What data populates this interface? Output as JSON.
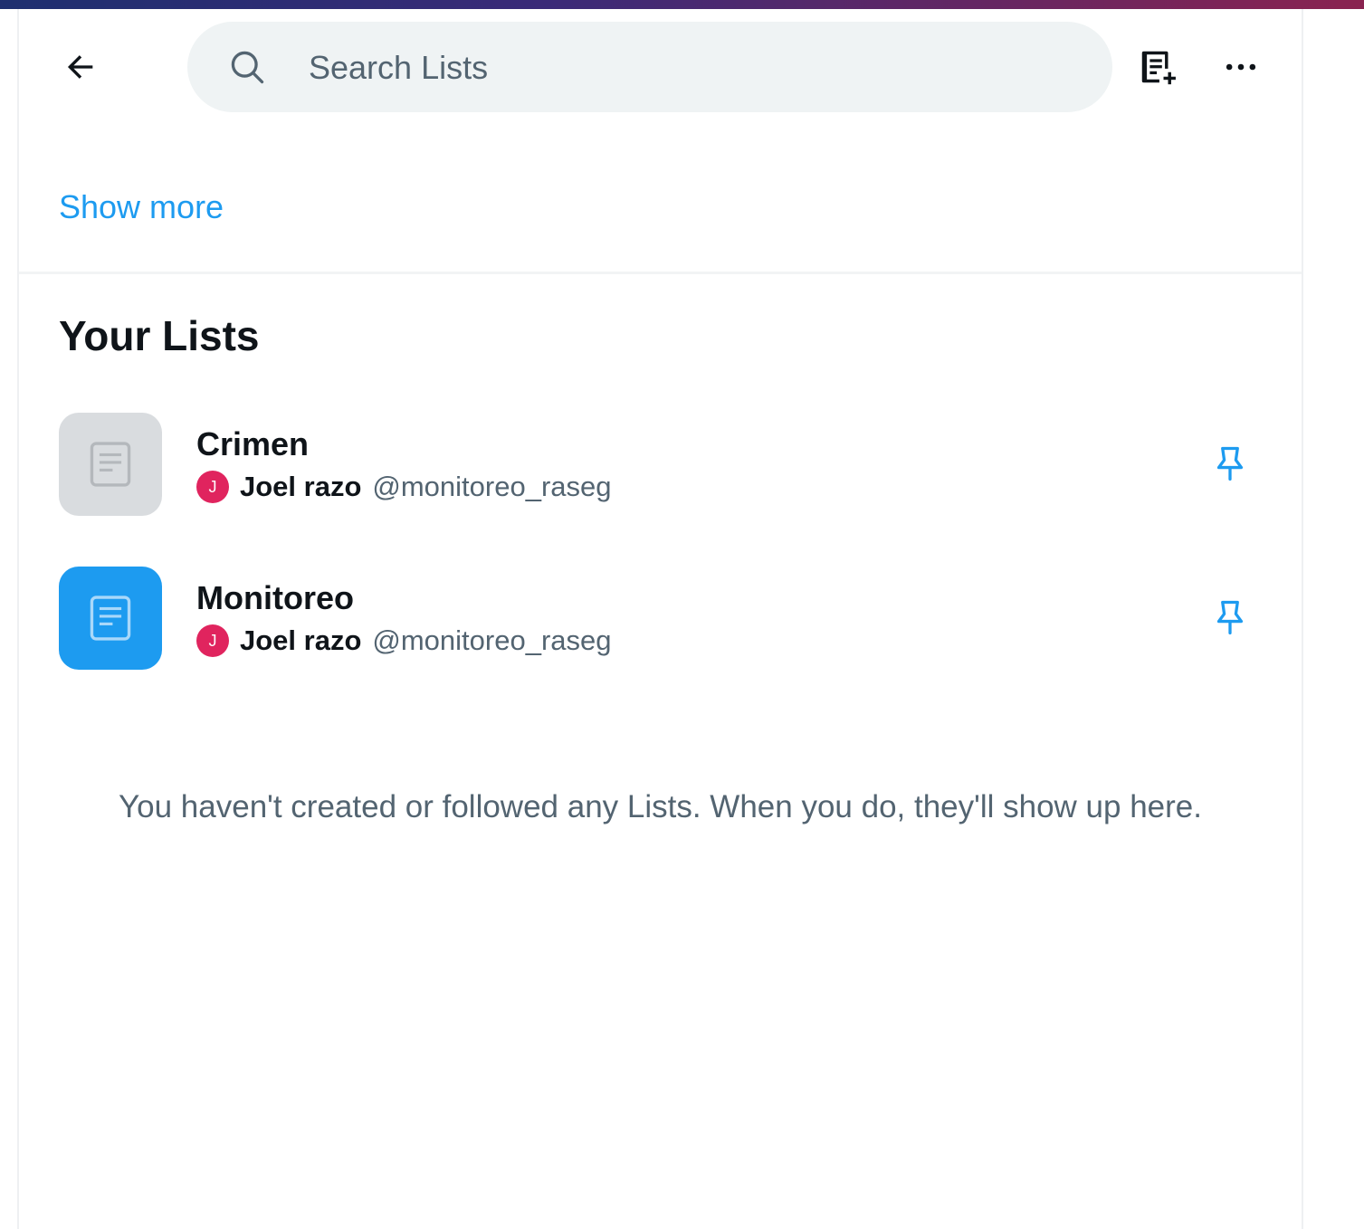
{
  "header": {
    "search_placeholder": "Search Lists",
    "back_icon": "arrow-left-icon",
    "create_icon": "create-list-icon",
    "more_icon": "more-horizontal-icon"
  },
  "show_more_label": "Show more",
  "your_lists": {
    "title": "Your Lists",
    "items": [
      {
        "name": "Crimen",
        "owner_initial": "J",
        "owner_name": "Joel razo",
        "owner_handle": "@monitoreo_raseg",
        "thumb_color": "#d9dcdf",
        "icon": "list-icon",
        "pin_icon": "pin-icon"
      },
      {
        "name": "Monitoreo",
        "owner_initial": "J",
        "owner_name": "Joel razo",
        "owner_handle": "@monitoreo_raseg",
        "thumb_color": "#1d9bf0",
        "icon": "list-icon",
        "pin_icon": "pin-icon"
      }
    ]
  },
  "empty_message": "You haven't created or followed any Lists. When you do, they'll show up here.",
  "colors": {
    "accent": "#1d9bf0",
    "avatar": "#e0245e",
    "text_primary": "#0f1419",
    "text_secondary": "#536471"
  }
}
